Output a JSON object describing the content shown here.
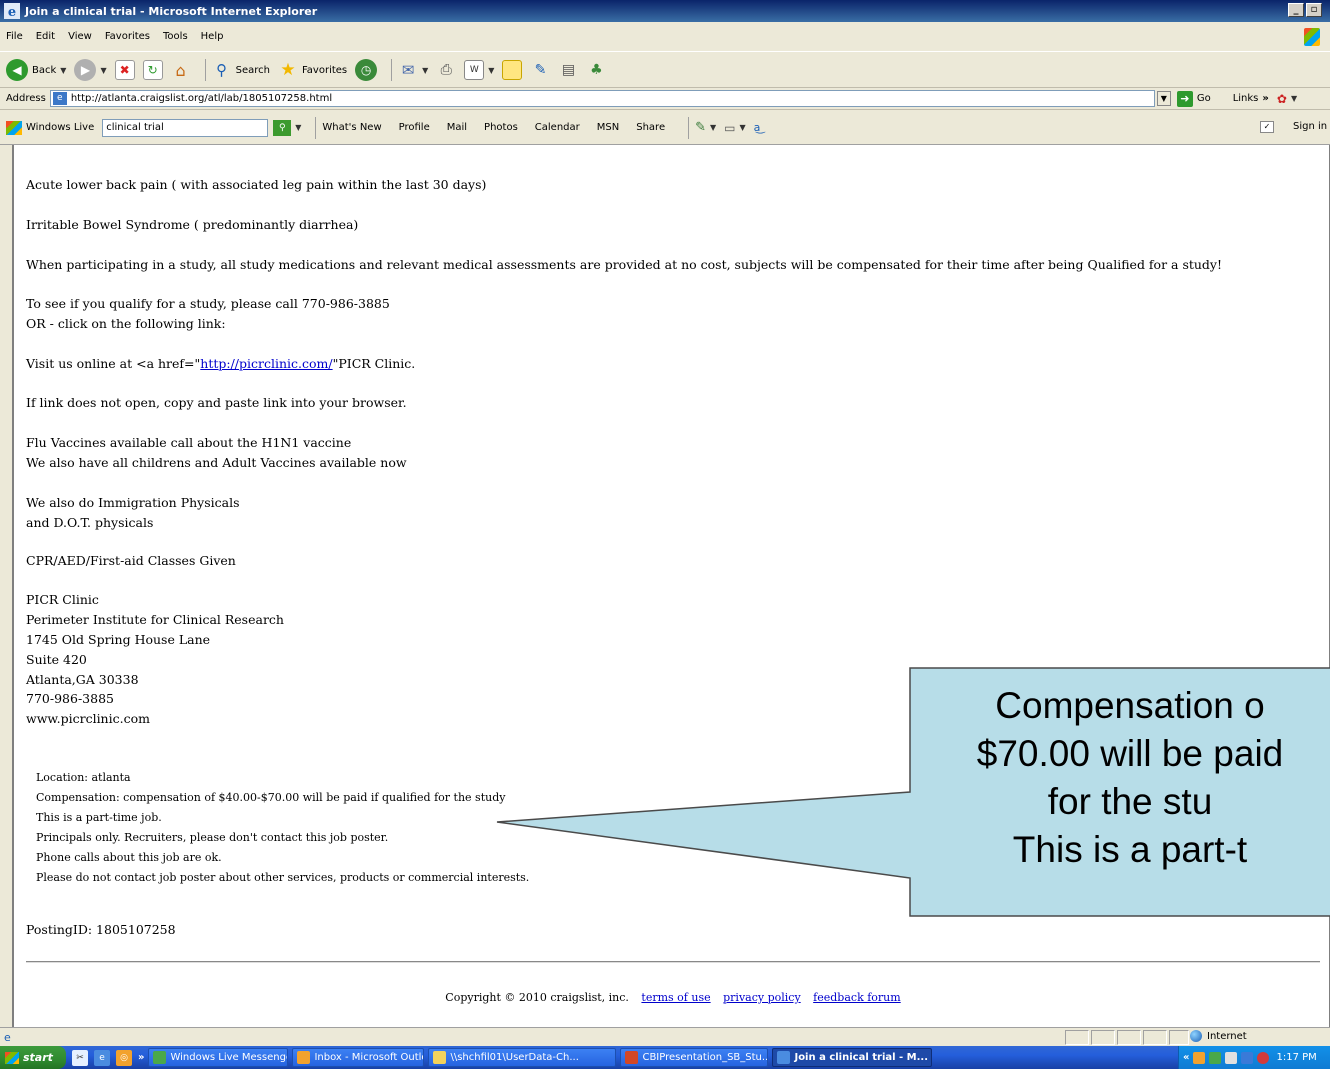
{
  "window": {
    "title": "Join a clinical trial - Microsoft Internet Explorer",
    "controls": [
      "_",
      "\u0000",
      "×"
    ]
  },
  "menu": [
    "File",
    "Edit",
    "View",
    "Favorites",
    "Tools",
    "Help"
  ],
  "toolbar": {
    "back_label": "Back",
    "search_label": "Search",
    "favorites_label": "Favorites"
  },
  "address": {
    "label": "Address",
    "url": "http://atlanta.craigslist.org/atl/lab/1805107258.html",
    "go_label": "Go",
    "links_label": "Links"
  },
  "windows_live": {
    "label": "Windows Live",
    "search_value": "clinical trial",
    "links": [
      "What's New",
      "Profile",
      "Mail",
      "Photos",
      "Calendar",
      "MSN",
      "Share"
    ],
    "sign_in": "Sign in"
  },
  "content": {
    "lines": [
      "Acute lower back pain ( with associated leg pain within the last 30 days)",
      "Irritable Bowel Syndrome ( predominantly diarrhea)",
      "When participating in a study, all study medications and relevant medical assessments are provided at no cost, subjects will be compensated for their time after being Qualified for a study!",
      "To see if you qualify for a study, please call 770-986-3885",
      "OR - click on the following link:",
      "If link does not open, copy and paste link into your browser.",
      "Flu Vaccines available call about the H1N1 vaccine",
      "We also have all childrens and Adult Vaccines available now",
      "We also do Immigration Physicals",
      "and D.O.T. physicals",
      "CPR/AED/First-aid Classes Given"
    ],
    "visit_prefix": "Visit us online at <a href=\"",
    "visit_link": "http://picrclinic.com/",
    "visit_suffix": "\"PICR Clinic.",
    "address_block": [
      "PICR Clinic",
      "Perimeter Institute for Clinical Research",
      "1745 Old Spring House Lane",
      "Suite 420",
      "Atlanta,GA 30338",
      "770-986-3885",
      "www.picrclinic.com"
    ],
    "details": [
      "Location: atlanta",
      "Compensation: compensation of $40.00-$70.00 will be paid if qualified for the study",
      "This is a part-time job.",
      "Principals only. Recruiters, please don't contact this job poster.",
      "Phone calls about this job are ok.",
      "Please do not contact job poster about other services, products or commercial interests."
    ],
    "posting_id": "PostingID: 1805107258",
    "copyright": "Copyright © 2010 craigslist, inc.",
    "footer_links": [
      "terms of use",
      "privacy policy",
      "feedback forum"
    ]
  },
  "callout": {
    "lines": [
      "Compensation o",
      "$70.00 will be paid",
      "for the stu",
      "This is a part-t"
    ],
    "fill": "#b7dde8",
    "stroke": "#4a4a4a"
  },
  "status": {
    "zone": "Internet"
  },
  "taskbar": {
    "start": "start",
    "tasks": [
      "Windows Live Messenger",
      "Inbox - Microsoft Outlook",
      "\\\\shchfil01\\UserData-Ch...",
      "CBIPresentation_SB_Stu...",
      "Join a clinical trial - M..."
    ],
    "clock": "1:17 PM"
  },
  "colors": {
    "title_bar": "#0a246a",
    "link": "#0000cc",
    "taskbar": "#245edb"
  }
}
